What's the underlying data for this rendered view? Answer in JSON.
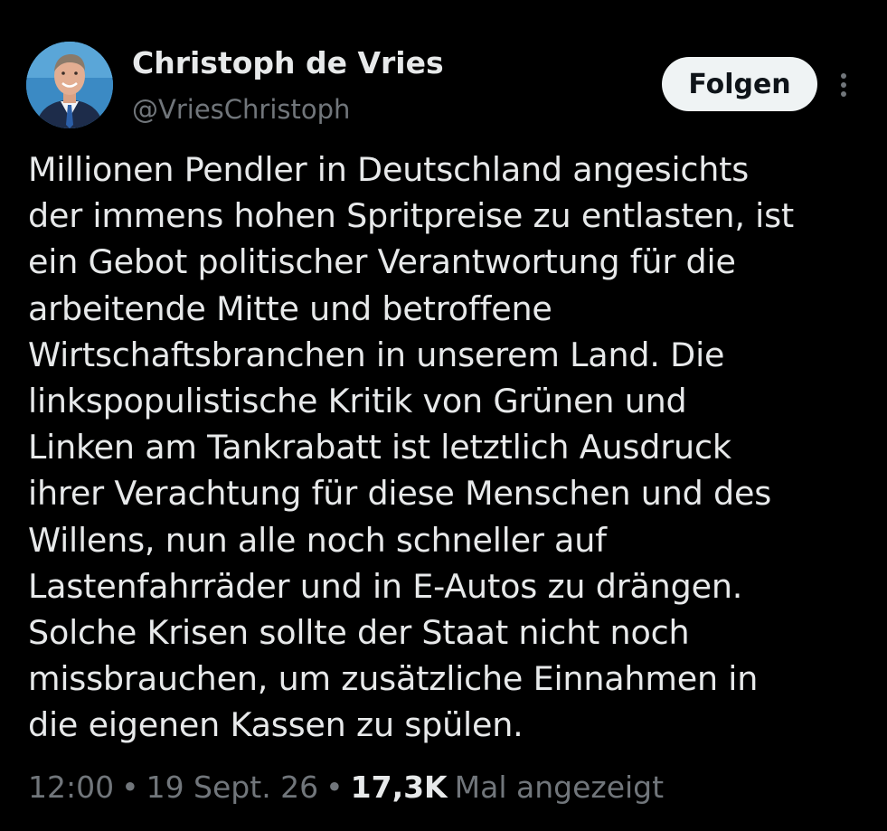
{
  "author": {
    "display_name": "Christoph de Vries",
    "handle": "@VriesChristoph"
  },
  "actions": {
    "follow_label": "Folgen"
  },
  "tweet": {
    "text": "Millionen Pendler in Deutschland angesichts\nder immens hohen Spritpreise zu entlasten, ist\nein Gebot politischer Verantwortung für die\narbeitende Mitte und betroffene\nWirtschaftsbranchen in unserem Land.  Die\nlinkspopulistische Kritik von Grünen und\nLinken am Tankrabatt ist letztlich Ausdruck\nihrer Verachtung für diese Menschen und des\nWillens, nun alle noch schneller auf\nLastenfahrräder und in E-Autos zu drängen.\nSolche Krisen sollte der Staat nicht noch\nmissbrauchen, um zusätzliche Einnahmen in\ndie eigenen Kassen zu spülen."
  },
  "meta": {
    "time": "12:00",
    "separator": "•",
    "date": "19 Sept. 26",
    "views_count": "17,3K",
    "views_label": "Mal angezeigt"
  },
  "icons": {
    "more": "more-vertical-icon"
  },
  "colors": {
    "background": "#000000",
    "text_primary": "#e7e9ea",
    "text_secondary": "#71767b",
    "button_bg": "#eff3f4",
    "button_text": "#0f1419"
  }
}
